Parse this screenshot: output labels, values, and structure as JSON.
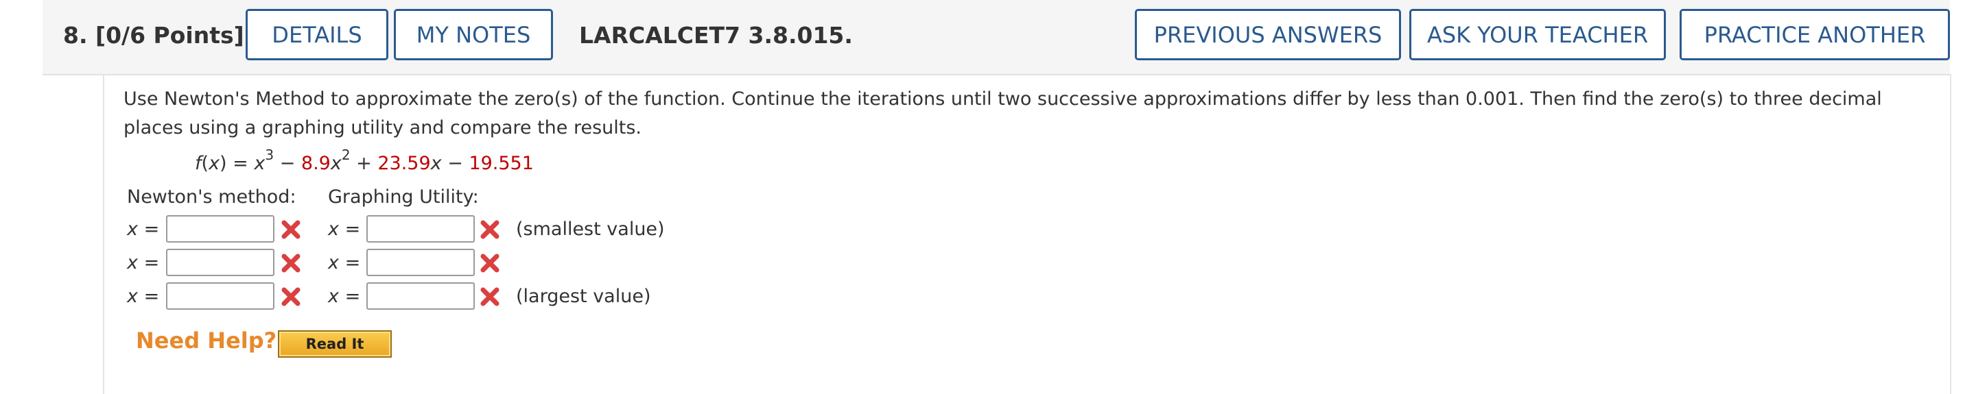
{
  "header": {
    "question_number": "8.",
    "points": "[0/6 Points]",
    "details_label": "DETAILS",
    "my_notes_label": "MY NOTES",
    "question_id": "LARCALCET7 3.8.015.",
    "previous_answers_label": "PREVIOUS ANSWERS",
    "ask_teacher_label": "ASK YOUR TEACHER",
    "practice_another_label": "PRACTICE ANOTHER",
    "button_color": "#2a5a8e"
  },
  "question": {
    "instructions": "Use Newton's Method to approximate the zero(s) of the function. Continue the iterations until two successive approximations differ by less than 0.001. Then find the zero(s) to three decimal places using a graphing utility and compare the results.",
    "function": {
      "lhs": "f(x) = x",
      "exp1": "3",
      "op1": " − ",
      "coef1": "8.9",
      "var1": "x",
      "exp2": "2",
      "op2": " + ",
      "coef2": "23.59",
      "var2": "x",
      "op3": " − ",
      "const": "19.551",
      "highlight_color": "#c00000"
    },
    "newton_header": "Newton's method:",
    "graphing_header": "Graphing Utility:",
    "x_label": "x",
    "equals": " =",
    "rows": [
      {
        "newton_value": "",
        "graph_value": "",
        "note": "(smallest value)"
      },
      {
        "newton_value": "",
        "graph_value": "",
        "note": ""
      },
      {
        "newton_value": "",
        "graph_value": "",
        "note": "(largest value)"
      }
    ],
    "incorrect_color": "#d94040"
  },
  "help": {
    "need_help_label": "Need Help?",
    "read_it_label": "Read It",
    "need_help_color": "#e8892c"
  }
}
